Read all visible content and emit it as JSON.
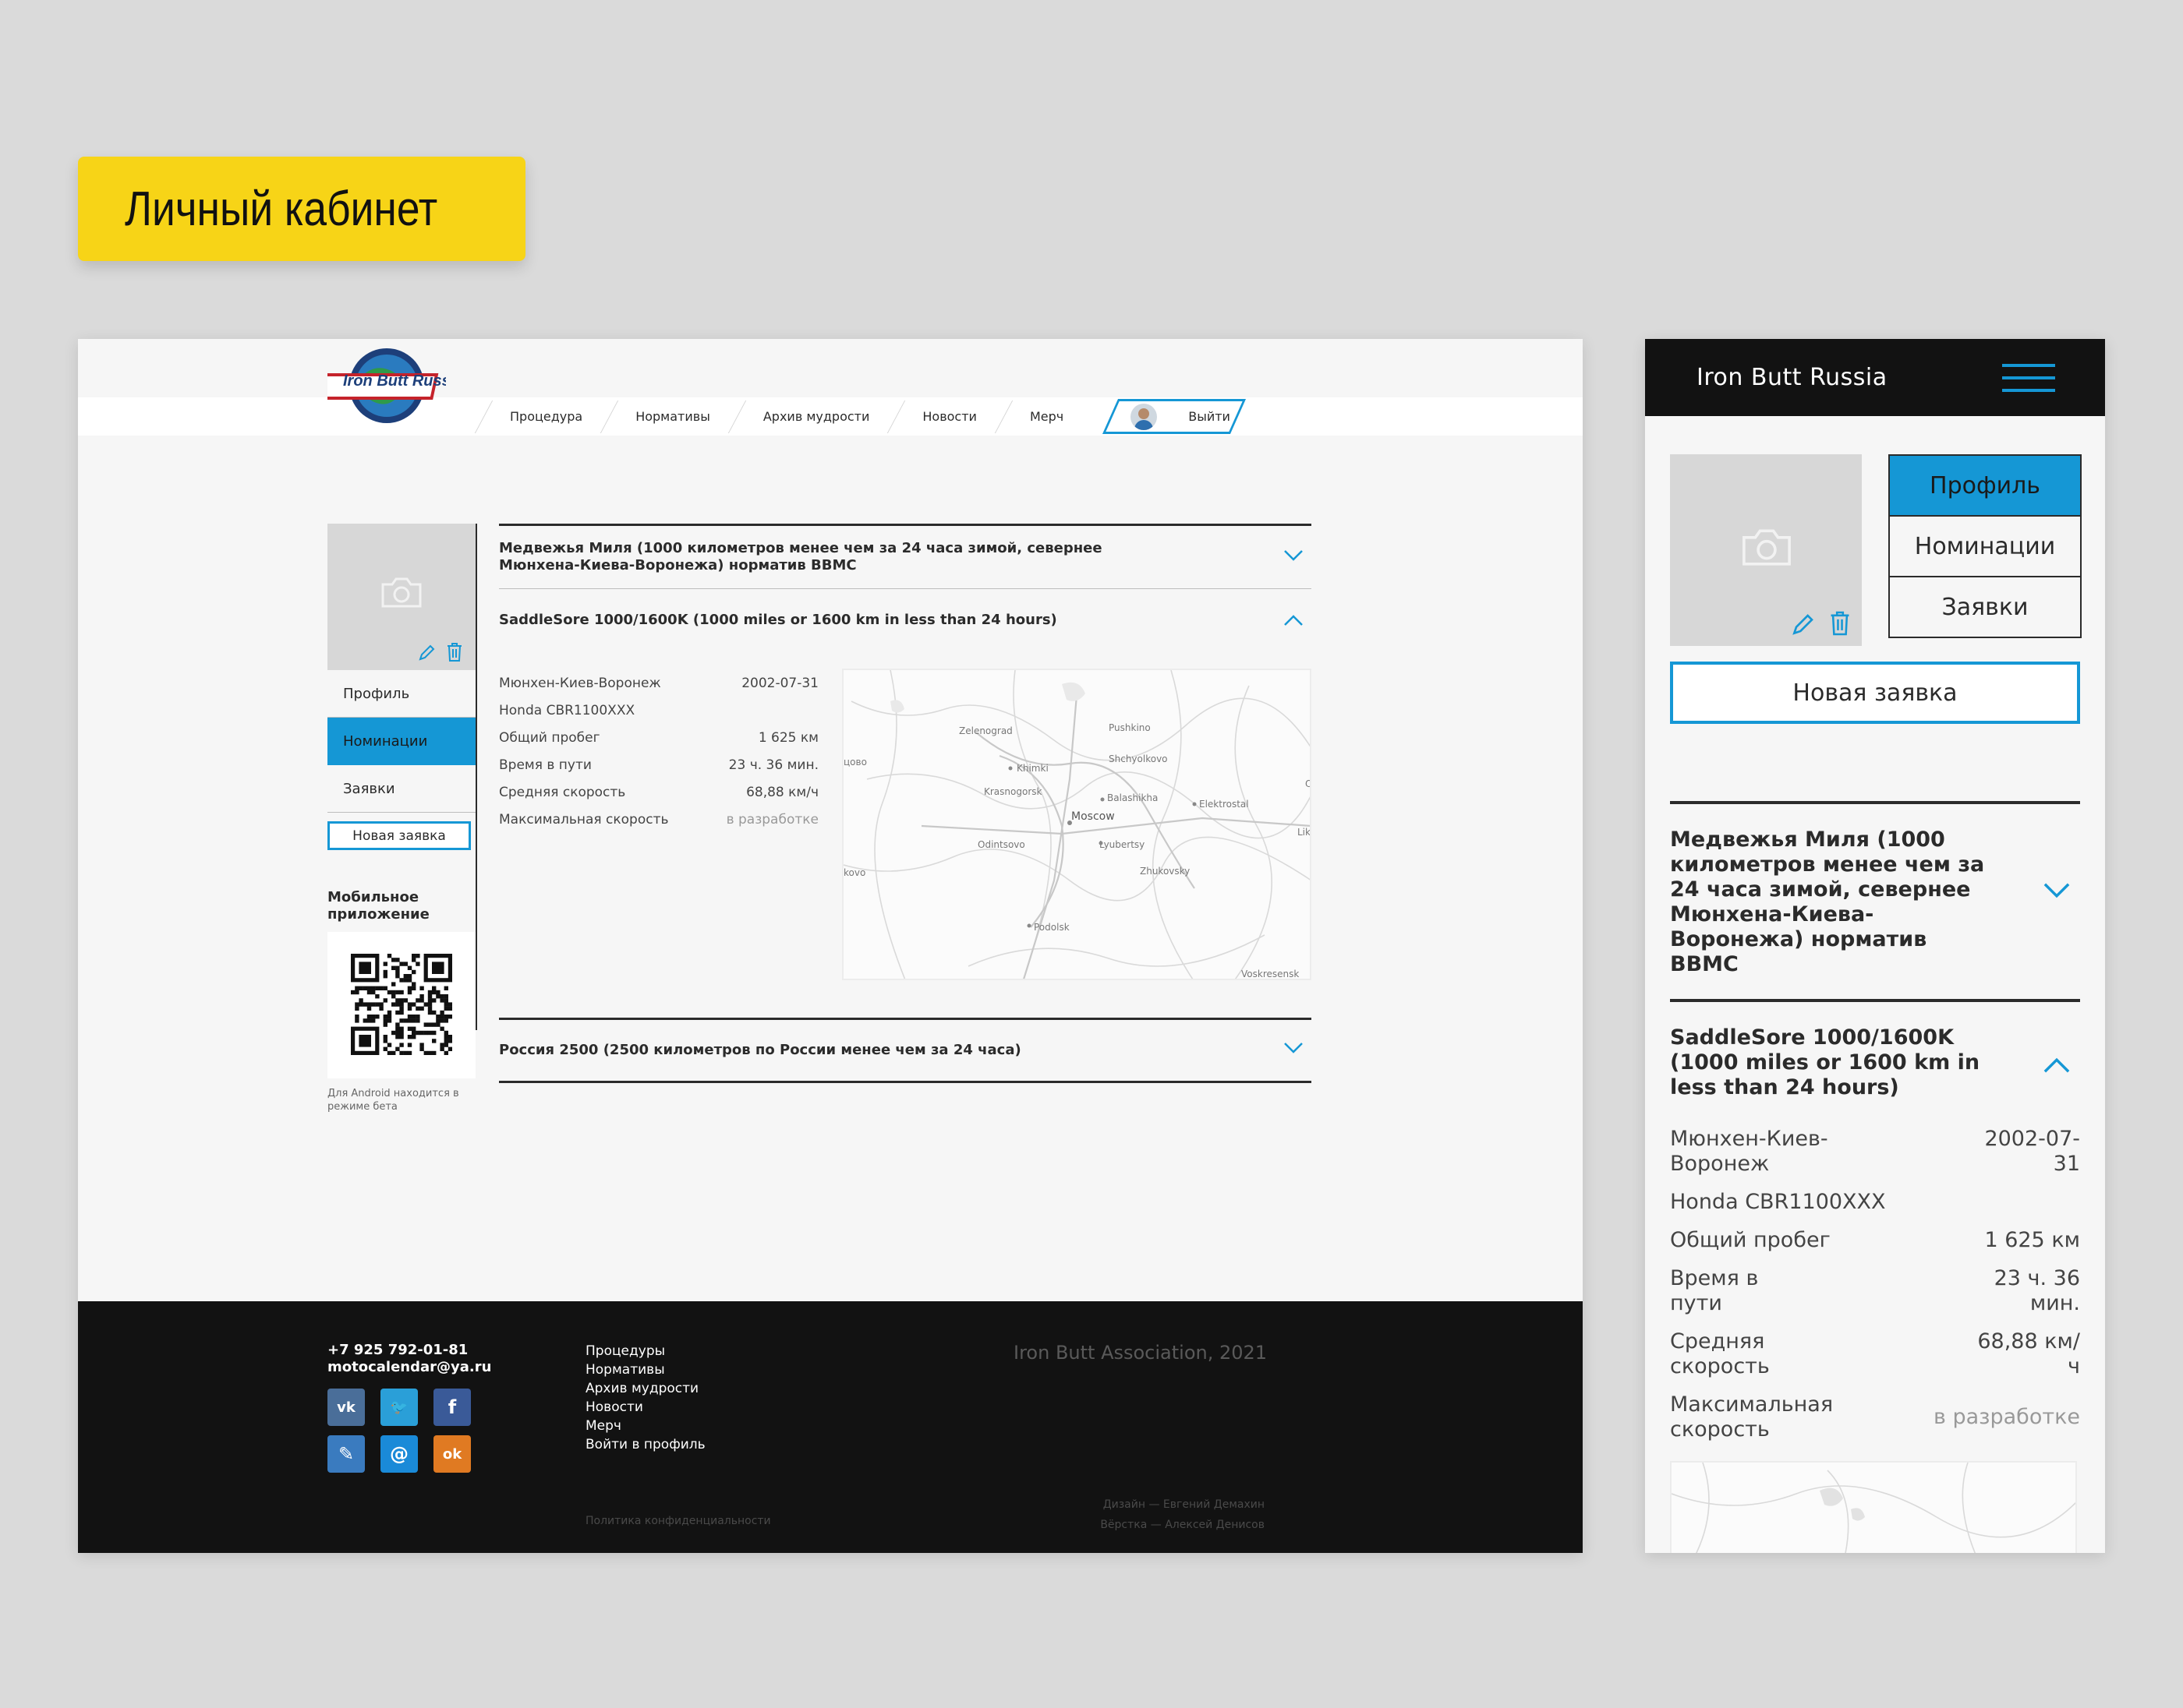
{
  "badge": {
    "title": "Личный кабинет"
  },
  "desktop": {
    "logo_text": "Iron Butt Russia",
    "nav": [
      "Процедура",
      "Нормативы",
      "Архив мудрости",
      "Новости",
      "Мерч"
    ],
    "logout_label": "Выйти",
    "sidebar": {
      "menu": [
        "Профиль",
        "Номинации",
        "Заявки"
      ],
      "active_index": 1,
      "new_request": "Новая заявка",
      "mobile_app_title": "Мобильное приложение",
      "android_note": "Для Android находится в режиме бета"
    },
    "accordion": [
      {
        "title": "Медвежья Миля (1000 километров менее чем за 24 часа зимой, севернее Мюнхена-Киева-Воронежа) норматив BBMC",
        "expanded": false
      },
      {
        "title": "SaddleSore 1000/1600K (1000 miles or 1600 km in less than 24 hours)",
        "expanded": true
      },
      {
        "title": "Россия 2500 (2500 километров по России менее чем за 24 часа)",
        "expanded": false
      }
    ],
    "stats": [
      {
        "k": "Мюнхен-Киев-Воронеж",
        "v": "2002-07-31"
      },
      {
        "k": "Honda CBR1100XXX",
        "v": ""
      },
      {
        "k": "Общий пробег",
        "v": "1 625 км"
      },
      {
        "k": "Время в пути",
        "v": "23 ч. 36 мин."
      },
      {
        "k": "Средняя скорость",
        "v": "68,88 км/ч"
      },
      {
        "k": "Максимальная скорость",
        "v": "в разработке"
      }
    ],
    "map_labels": {
      "zelenograd": "Zelenograd",
      "pushkino": "Pushkino",
      "shchyolkovo": "Shchyolkovo",
      "khimki": "Khimki",
      "krasnogorsk": "Krasnogorsk",
      "balashikha": "Balashikha",
      "elektrostal": "Elektrostal",
      "moscow": "Moscow",
      "odintsovo": "Odintsovo",
      "lyubertsy": "Lyubertsy",
      "zhukovsky": "Zhukovsky",
      "podolsk": "Podolsk",
      "voskresensk": "Voskresensk",
      "edge_left_top": "цово",
      "edge_left_bottom": "kovo",
      "edge_right": "Liki",
      "edge_right_top": "O"
    },
    "footer": {
      "phone": "+7 925 792-01-81",
      "email": "motocalendar@ya.ru",
      "links": [
        "Процедуры",
        "Нормативы",
        "Архив мудрости",
        "Новости",
        "Мерч",
        "Войти в профиль"
      ],
      "copyright": "Iron Butt Association, 2021",
      "policy": "Политика конфиденциальности",
      "credit_design": "Дизайн — Евгений Демахин",
      "credit_dev": "Вёрстка — Алексей Денисов",
      "social": [
        {
          "icon": "vk-icon",
          "glyph": "vk",
          "color": "#4a6e99"
        },
        {
          "icon": "twitter-icon",
          "glyph": "🐦",
          "color": "#2a9fd8"
        },
        {
          "icon": "facebook-icon",
          "glyph": "f",
          "color": "#3a5a98"
        },
        {
          "icon": "livejournal-icon",
          "glyph": "✎",
          "color": "#3a7bbf"
        },
        {
          "icon": "mail-icon",
          "glyph": "@",
          "color": "#1a8ad8"
        },
        {
          "icon": "odnoklassniki-icon",
          "glyph": "ok",
          "color": "#e07a22"
        }
      ]
    }
  },
  "mobile": {
    "brand": "Iron Butt Russia",
    "tabs": [
      "Профиль",
      "Номинации",
      "Заявки"
    ],
    "active_tab": 0,
    "new_request": "Новая заявка",
    "accordion": [
      {
        "title": "Медвежья Миля (1000 километров менее чем за 24 часа зимой, севернее Мюнхена-Киева-Воронежа) норматив BBMC"
      },
      {
        "title": "SaddleSore 1000/1600K (1000 miles or 1600 km in less than 24 hours)"
      }
    ],
    "stats": [
      {
        "k": "Мюнхен-Киев-Воронеж",
        "v": "2002-07-31"
      },
      {
        "k": "Honda CBR1100XXX",
        "v": ""
      },
      {
        "k": "Общий пробег",
        "v": "1 625 км"
      },
      {
        "k": "Время в пути",
        "v": "23 ч. 36 мин."
      },
      {
        "k": "Средняя скорость",
        "v": "68,88 км/ч"
      },
      {
        "k": "Максимальная скорость",
        "v": "в разработке"
      }
    ]
  },
  "colors": {
    "accent": "#1597d5",
    "badge": "#f7d417",
    "dark": "#121212",
    "panel": "#d7d7d7"
  }
}
